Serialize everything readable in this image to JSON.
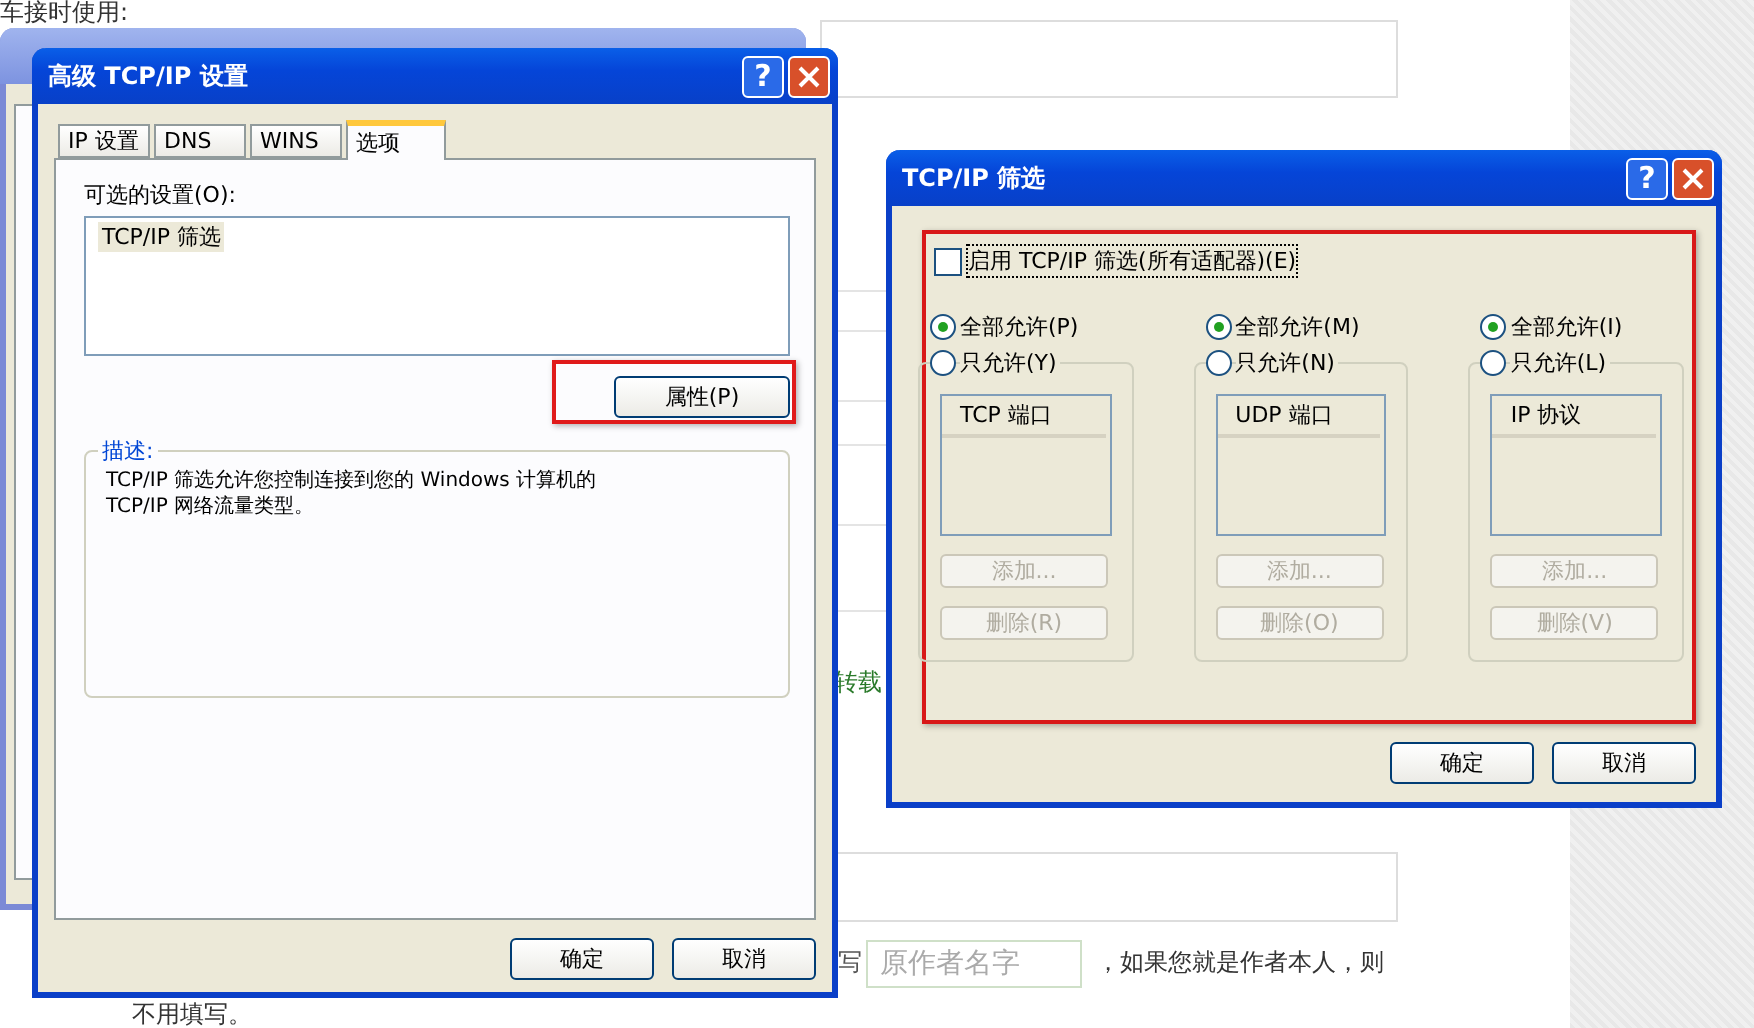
{
  "page": {
    "top_text": "车接时使用:",
    "side_link": "转载",
    "author_prefix": "写",
    "author_field": {
      "placeholder": "原作者名字"
    },
    "author_suffix": "，如果您就是作者本人，则",
    "note": "不用填写。"
  },
  "advanced_window": {
    "title": "高级 TCP/IP 设置",
    "help": "?",
    "tabs": [
      {
        "label": "IP 设置",
        "selected": false
      },
      {
        "label": "DNS",
        "selected": false
      },
      {
        "label": "WINS",
        "selected": false
      },
      {
        "label": "选项",
        "selected": true
      }
    ],
    "optional_label": "可选的设置(O):",
    "settings": [
      {
        "label": "TCP/IP 筛选",
        "selected": true
      }
    ],
    "properties_button": "属性(P)",
    "description_title": "描述:",
    "description_lines": [
      "TCP/IP 筛选允许您控制连接到您的 Windows 计算机的",
      "TCP/IP 网络流量类型。"
    ],
    "buttons": [
      "确定",
      "取消"
    ]
  },
  "filter_window": {
    "title": "TCP/IP 筛选",
    "help": "?",
    "enable": {
      "label": "启用 TCP/IP 筛选(所有适配器)(E)",
      "checked": false
    },
    "columns": [
      {
        "options": [
          {
            "label": "全部允许(P)",
            "selected": true
          },
          {
            "label": "只允许(Y)",
            "selected": false
          }
        ],
        "list_header": "TCP 端口",
        "buttons": [
          {
            "label": "添加...",
            "disabled": true
          },
          {
            "label": "删除(R)",
            "disabled": true
          }
        ]
      },
      {
        "options": [
          {
            "label": "全部允许(M)",
            "selected": true
          },
          {
            "label": "只允许(N)",
            "selected": false
          }
        ],
        "list_header": "UDP 端口",
        "buttons": [
          {
            "label": "添加...",
            "disabled": true
          },
          {
            "label": "删除(O)",
            "disabled": true
          }
        ]
      },
      {
        "options": [
          {
            "label": "全部允许(I)",
            "selected": true
          },
          {
            "label": "只允许(L)",
            "selected": false
          }
        ],
        "list_header": "IP 协议",
        "buttons": [
          {
            "label": "添加...",
            "disabled": true
          },
          {
            "label": "删除(V)",
            "disabled": true
          }
        ]
      }
    ],
    "buttons": [
      "确定",
      "取消"
    ]
  }
}
